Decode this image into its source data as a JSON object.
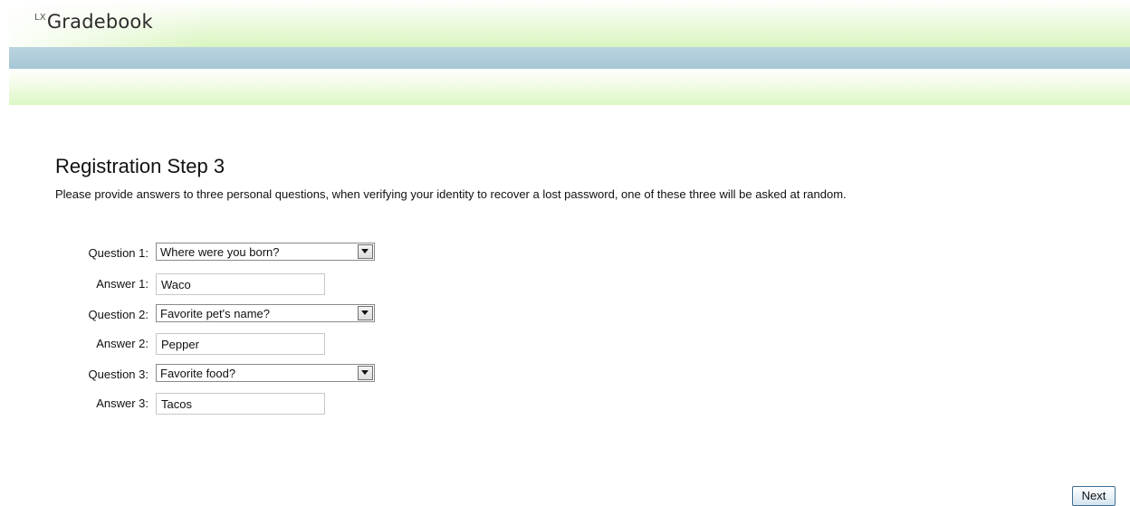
{
  "app": {
    "logo_prefix": "LX",
    "logo_text": "Gradebook"
  },
  "page": {
    "title": "Registration Step 3",
    "instructions": "Please provide answers to three personal questions, when verifying your identity to recover a lost password, one of these three will be asked at random."
  },
  "form": {
    "rows": [
      {
        "question_label": "Question 1:",
        "question_value": "Where were you born?",
        "answer_label": "Answer 1:",
        "answer_value": "Waco"
      },
      {
        "question_label": "Question 2:",
        "question_value": "Favorite pet's name?",
        "answer_label": "Answer 2:",
        "answer_value": "Pepper"
      },
      {
        "question_label": "Question 3:",
        "question_value": "Favorite food?",
        "answer_label": "Answer 3:",
        "answer_value": "Tacos"
      }
    ]
  },
  "actions": {
    "next_label": "Next"
  },
  "colors": {
    "header_band": "#a6c7d6",
    "header_green": "#d9f5bf",
    "button_border": "#3f6e93"
  }
}
